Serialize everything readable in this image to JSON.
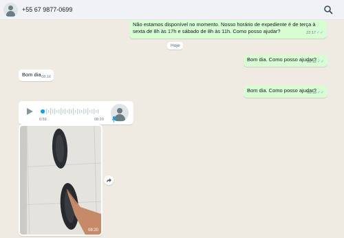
{
  "header": {
    "contact_name": "+55 67 9877-0699"
  },
  "messages": [
    {
      "text": "Não estamos disponível no momento. Nosso horário de expediente é de terça à sexta de 8h às 17h e sábado de 8h às 11h. Como posso ajudar?",
      "time": "22:17",
      "ticks": "✓✓"
    },
    {
      "text": "Bom dia. Como posso ajudar?",
      "time": "08:12",
      "ticks": "✓✓"
    },
    {
      "text": "Bom dia",
      "time": "08:16"
    },
    {
      "text": "Bom dia. Como posso ajudar?",
      "time": "08:18",
      "ticks": "✓✓"
    }
  ],
  "day_label": "Hoje",
  "audio": {
    "duration": "0:59",
    "time": "08:20"
  },
  "video": {
    "time": "08:20"
  },
  "colors": {
    "outgoing_bubble": "#d9fdd3",
    "incoming_bubble": "#ffffff",
    "read_ticks": "#53bdeb",
    "audio_accent": "#00a5f4"
  }
}
